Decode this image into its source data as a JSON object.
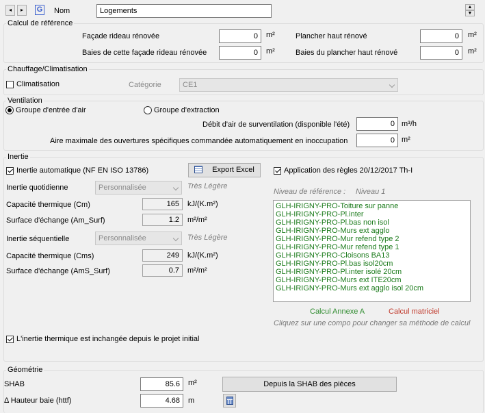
{
  "header": {
    "nav_prev": "◂",
    "nav_next": "▸",
    "g_icon": "G",
    "nom_label": "Nom",
    "nom_value": "Logements",
    "spin_up": "▲",
    "spin_down": "▼"
  },
  "calcul": {
    "title": "Calcul de référence",
    "facade_label": "Façade rideau rénovée",
    "facade_value": "0",
    "baies_facade_label": "Baies de cette façade rideau rénovée",
    "baies_facade_value": "0",
    "plancher_label": "Plancher haut rénové",
    "plancher_value": "0",
    "baies_plancher_label": "Baies du plancher haut rénové",
    "baies_plancher_value": "0",
    "unit_m2": "m²"
  },
  "chauffage": {
    "title": "Chauffage/Climatisation",
    "climatisation_label": "Climatisation",
    "categorie_label": "Catégorie",
    "categorie_value": "CE1"
  },
  "ventilation": {
    "title": "Ventilation",
    "groupe_entree": "Groupe d'entrée d'air",
    "groupe_extraction": "Groupe d'extraction",
    "debit_label": "Débit d'air de surventilation (disponible l'été)",
    "debit_value": "0",
    "debit_unit": "m³/h",
    "aire_label": "Aire maximale des ouvertures spécifiques commandée automatiquement en inoccupation",
    "aire_value": "0",
    "aire_unit": "m²"
  },
  "inertie": {
    "title": "Inertie",
    "auto_label": "Inertie automatique (NF EN ISO 13786)",
    "export_label": "Export Excel",
    "application_label": "Application des règles  20/12/2017 Th-I",
    "quotidienne_label": "Inertie quotidienne",
    "quotidienne_value": "Personnalisée",
    "quotidienne_hint": "Très Légère",
    "cm_label": "Capacité thermique (Cm)",
    "cm_value": "165",
    "cm_unit": "kJ/(K.m²)",
    "am_label": "Surface d'échange (Am_Surf)",
    "am_value": "1.2",
    "am_unit": "m²/m²",
    "sequentielle_label": "Inertie séquentielle",
    "sequentielle_value": "Personnalisée",
    "sequentielle_hint": "Très Légère",
    "cms_label": "Capacité thermique (Cms)",
    "cms_value": "249",
    "cms_unit": "kJ/(K.m²)",
    "ams_label": "Surface d'échange (AmS_Surf)",
    "ams_value": "0.7",
    "ams_unit": "m²/m²",
    "niveau_label": "Niveau de référence :",
    "niveau_value": "Niveau 1",
    "compos": [
      "GLH-IRIGNY-PRO-Toiture sur panne",
      "GLH-IRIGNY-PRO-Pl.inter",
      "GLH-IRIGNY-PRO-Pl.bas non isol",
      "GLH-IRIGNY-PRO-Murs ext agglo",
      "GLH-IRIGNY-PRO-Mur refend type 2",
      "GLH-IRIGNY-PRO-Mur refend type 1",
      "GLH-IRIGNY-PRO-Cloisons BA13",
      "GLH-IRIGNY-PRO-Pl.bas isol20cm",
      "GLH-IRIGNY-PRO-Pl.inter isolé 20cm",
      "GLH-IRIGNY-PRO-Murs ext ITE20cm",
      "GLH-IRIGNY-PRO-Murs ext agglo isol 20cm"
    ],
    "calcul_annexe": "Calcul Annexe A",
    "calcul_matriciel": "Calcul matriciel",
    "hint_compo": "Cliquez sur une compo pour changer sa méthode de calcul",
    "inchangee_label": "L'inertie thermique est inchangée depuis le projet initial"
  },
  "geometrie": {
    "title": "Géométrie",
    "shab_label": "SHAB",
    "shab_value": "85.6",
    "shab_unit": "m²",
    "depuis_label": "Depuis la SHAB des pièces",
    "hauteur_label": "Δ Hauteur baie (httf)",
    "hauteur_value": "4.68",
    "hauteur_unit": "m"
  },
  "colors": {
    "list_text": "#1a7a1a",
    "calcul_annexe": "#2e8b2e",
    "calcul_matriciel": "#c0392b"
  }
}
